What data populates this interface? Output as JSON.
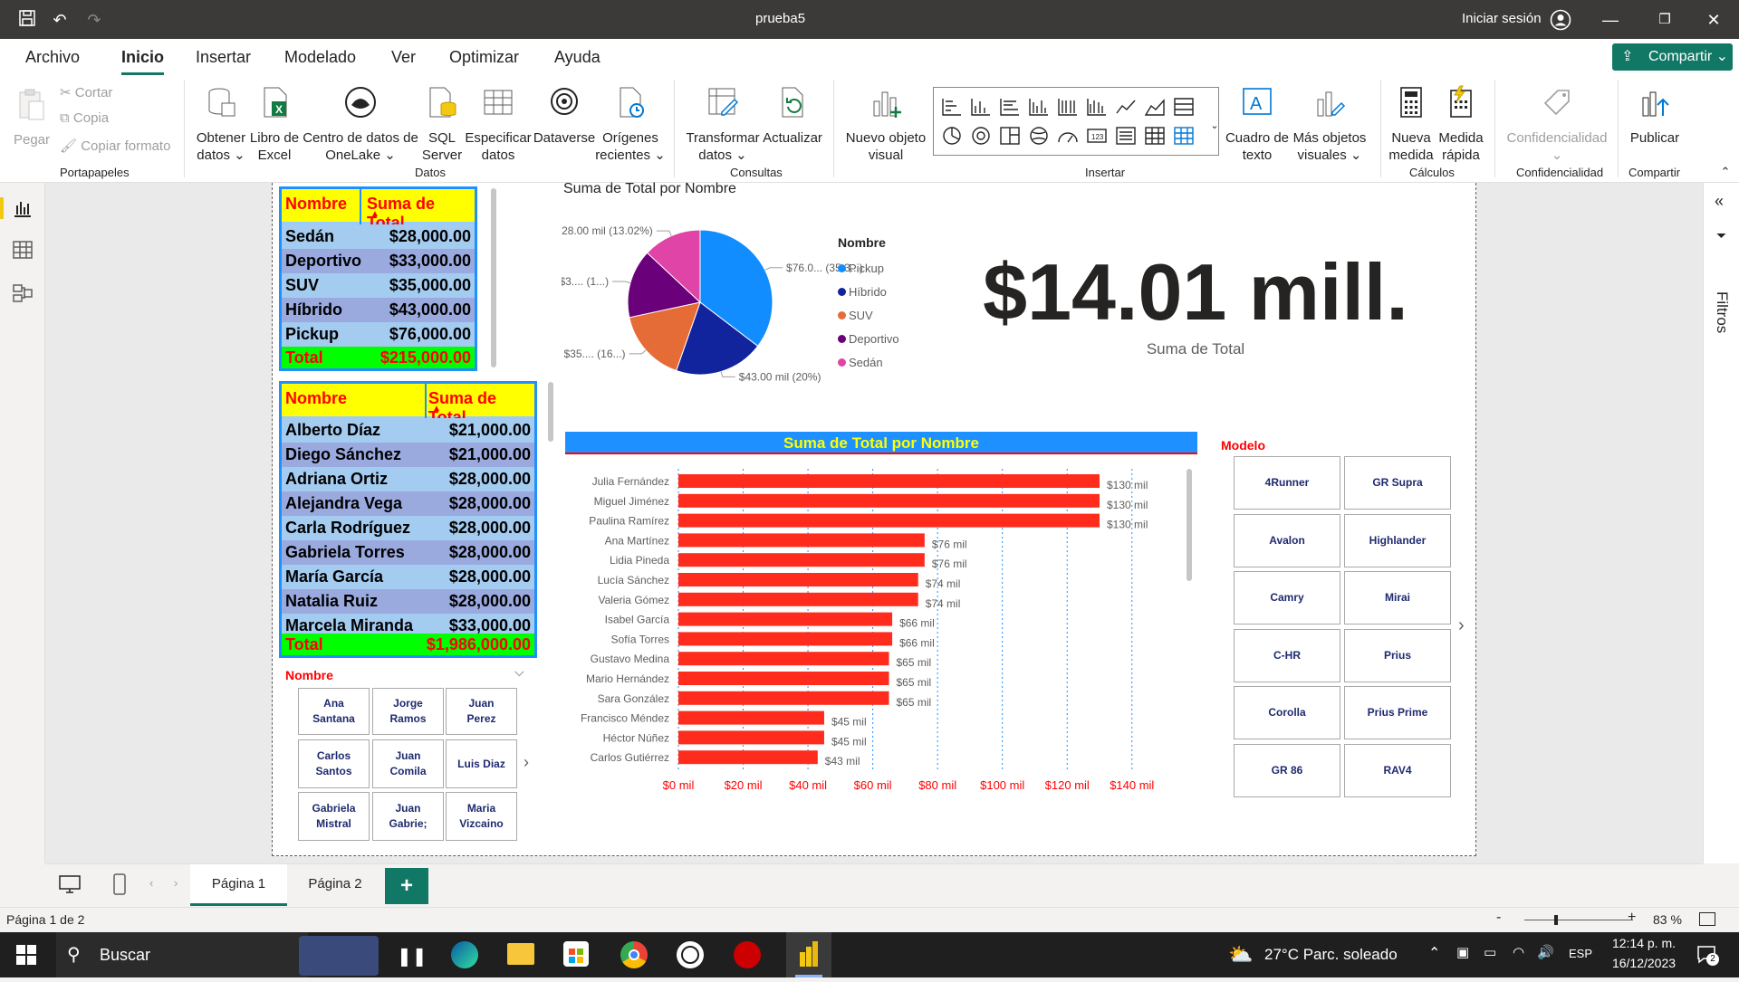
{
  "window": {
    "title": "prueba5",
    "signin": "Iniciar sesión"
  },
  "menu": {
    "tabs": [
      "Archivo",
      "Inicio",
      "Insertar",
      "Modelado",
      "Ver",
      "Optimizar",
      "Ayuda"
    ],
    "share": "Compartir"
  },
  "ribbon": {
    "clipboard": {
      "paste": "Pegar",
      "cut": "Cortar",
      "copy": "Copia",
      "format": "Copiar formato",
      "group": "Portapapeles"
    },
    "data": {
      "get_data": [
        "Obtener",
        "datos ⌄"
      ],
      "excel": [
        "Libro de",
        "Excel"
      ],
      "onelake": [
        "Centro de datos de",
        "OneLake ⌄"
      ],
      "sql": [
        "SQL",
        "Server"
      ],
      "enter": [
        "Especificar",
        "datos"
      ],
      "dataverse": [
        "Dataverse",
        ""
      ],
      "recent": [
        "Orígenes",
        "recientes ⌄"
      ],
      "group": "Datos"
    },
    "queries": {
      "transform": [
        "Transformar",
        "datos ⌄"
      ],
      "refresh": [
        "Actualizar",
        ""
      ],
      "group": "Consultas"
    },
    "insert": {
      "new_visual": [
        "Nuevo objeto",
        "visual"
      ],
      "textbox": [
        "Cuadro de",
        "texto"
      ],
      "more_visuals": [
        "Más objetos",
        "visuales ⌄"
      ],
      "group": "Insertar"
    },
    "calc": {
      "new_measure": [
        "Nueva",
        "medida"
      ],
      "quick_measure": [
        "Medida",
        "rápida"
      ],
      "group": "Cálculos"
    },
    "sensitivity": {
      "label": "Confidencialidad",
      "group": "Confidencialidad"
    },
    "share": {
      "publish": "Publicar",
      "group": "Compartir"
    }
  },
  "filters_pane": "Filtros",
  "table1": {
    "headers": [
      "Nombre",
      "Suma de Total"
    ],
    "rows": [
      [
        "Sedán",
        "$28,000.00"
      ],
      [
        "Deportivo",
        "$33,000.00"
      ],
      [
        "SUV",
        "$35,000.00"
      ],
      [
        "Híbrido",
        "$43,000.00"
      ],
      [
        "Pickup",
        "$76,000.00"
      ]
    ],
    "total": [
      "Total",
      "$215,000.00"
    ]
  },
  "table2": {
    "headers": [
      "Nombre",
      "Suma de Total"
    ],
    "rows": [
      [
        "Alberto Díaz",
        "$21,000.00"
      ],
      [
        "Diego Sánchez",
        "$21,000.00"
      ],
      [
        "Adriana Ortiz",
        "$28,000.00"
      ],
      [
        "Alejandra Vega",
        "$28,000.00"
      ],
      [
        "Carla Rodríguez",
        "$28,000.00"
      ],
      [
        "Gabriela Torres",
        "$28,000.00"
      ],
      [
        "María García",
        "$28,000.00"
      ],
      [
        "Natalia Ruiz",
        "$28,000.00"
      ],
      [
        "Marcela Miranda",
        "$33,000.00"
      ]
    ],
    "total": [
      "Total",
      "$1,986,000.00"
    ]
  },
  "slicer_nombre": {
    "title": "Nombre",
    "items": [
      [
        "Ana",
        "Santana"
      ],
      [
        "Jorge",
        "Ramos"
      ],
      [
        "Juan",
        "Perez"
      ],
      [
        "Carlos",
        "Santos"
      ],
      [
        "Juan",
        "Comila"
      ],
      [
        "Luis Diaz",
        ""
      ],
      [
        "Gabriela",
        "Mistral"
      ],
      [
        "Juan",
        "Gabrie;"
      ],
      [
        "Maria",
        "Vizcaino"
      ]
    ]
  },
  "slicer_modelo": {
    "title": "Modelo",
    "items": [
      "4Runner",
      "GR Supra",
      "Avalon",
      "Highlander",
      "Camry",
      "Mirai",
      "C-HR",
      "Prius",
      "Corolla",
      "Prius Prime",
      "GR 86",
      "RAV4"
    ]
  },
  "kpi": {
    "value": "$14.01 mill.",
    "label": "Suma de Total"
  },
  "chart_data": [
    {
      "type": "pie",
      "title": "Suma de Total por Nombre",
      "legend_title": "Nombre",
      "legend_position": "right",
      "slices": [
        {
          "name": "Pickup",
          "value": 76000,
          "color": "#118dff",
          "label": "$76.0... (35.3...)"
        },
        {
          "name": "Híbrido",
          "value": 43000,
          "color": "#12239e",
          "label": "$43.00 mil (20%)"
        },
        {
          "name": "SUV",
          "value": 35000,
          "color": "#e66c37",
          "label": "$35.... (16...)"
        },
        {
          "name": "Deportivo",
          "value": 33000,
          "color": "#6b007b",
          "label": "$3.... (1...)"
        },
        {
          "name": "Sedán",
          "value": 28000,
          "color": "#e044a7",
          "label": "$28.00 mil (13.02%)"
        }
      ]
    },
    {
      "type": "bar",
      "orientation": "horizontal",
      "title": "Suma de Total por Nombre",
      "title_bg": "#1e90ff",
      "title_color": "#ffff00",
      "bar_color": "#ff2b1c",
      "xlim": [
        0,
        140
      ],
      "x_ticks": [
        "$0 mil",
        "$20 mil",
        "$40 mil",
        "$60 mil",
        "$80 mil",
        "$100 mil",
        "$120 mil",
        "$140 mil"
      ],
      "categories": [
        "Julia Fernández",
        "Miguel Jiménez",
        "Paulina Ramírez",
        "Ana Martínez",
        "Lidia Pineda",
        "Lucía Sánchez",
        "Valeria Gómez",
        "Isabel García",
        "Sofía Torres",
        "Gustavo Medina",
        "Mario Hernández",
        "Sara González",
        "Francisco Méndez",
        "Héctor Núñez",
        "Carlos Gutiérrez"
      ],
      "values": [
        130,
        130,
        130,
        76,
        76,
        74,
        74,
        66,
        66,
        65,
        65,
        65,
        45,
        45,
        43
      ],
      "labels": [
        "$130 mil",
        "$130 mil",
        "$130 mil",
        "$76 mil",
        "$76 mil",
        "$74 mil",
        "$74 mil",
        "$66 mil",
        "$66 mil",
        "$65 mil",
        "$65 mil",
        "$65 mil",
        "$45 mil",
        "$45 mil",
        "$43 mil"
      ]
    }
  ],
  "pages": {
    "tabs": [
      "Página 1",
      "Página 2"
    ],
    "add": "+"
  },
  "status": {
    "page": "Página 1 de 2",
    "zoom": "83 %"
  },
  "taskbar": {
    "search": "Buscar",
    "weather": "27°C  Parc. soleado",
    "lang": "ESP",
    "time": "12:14 p. m.",
    "date": "16/12/2023",
    "notif": "2"
  }
}
